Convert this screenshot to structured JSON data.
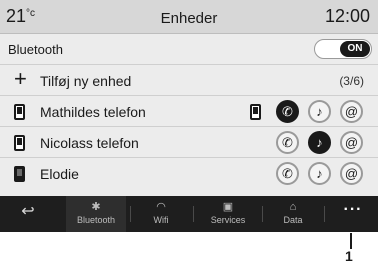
{
  "status": {
    "temp": "21",
    "temp_unit": "°c",
    "title": "Enheder",
    "clock": "12:00"
  },
  "bluetooth": {
    "label": "Bluetooth",
    "toggle": "ON"
  },
  "add_device": {
    "label": "Tilføj ny enhed",
    "count": "(3/6)"
  },
  "devices": [
    {
      "name": "Mathildes telefon",
      "active": true,
      "call_on": true,
      "music_on": false
    },
    {
      "name": "Nicolass telefon",
      "active": false,
      "call_on": false,
      "music_on": true
    },
    {
      "name": "Elodie",
      "active": false,
      "call_on": false,
      "music_on": false
    }
  ],
  "nav": {
    "back_icon": "↩",
    "items": [
      {
        "label": "Bluetooth",
        "icon": "bluetooth-icon"
      },
      {
        "label": "Wifi",
        "icon": "wifi-icon"
      },
      {
        "label": "Services",
        "icon": "services-icon"
      },
      {
        "label": "Data",
        "icon": "data-icon"
      }
    ],
    "more": "···"
  },
  "callout": "1"
}
